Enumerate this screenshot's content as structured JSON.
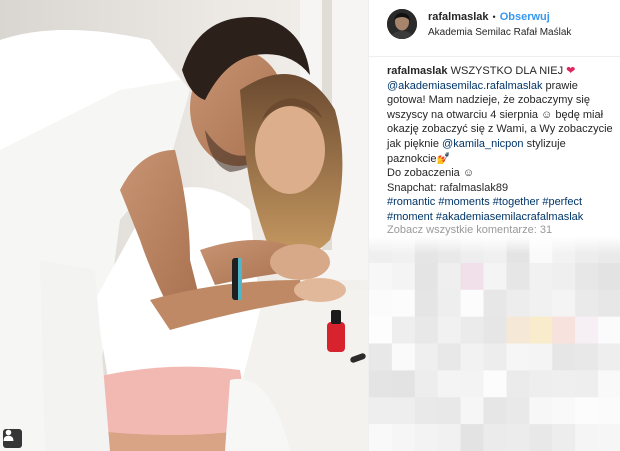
{
  "post": {
    "username": "rafalmaslak",
    "follow_label": "Obserwuj",
    "location": "Akademia Semilac Rafał Maślak"
  },
  "caption": {
    "username": "rafalmaslak",
    "line1_text": "WSZYSTKO DLA NIEJ",
    "mention_academy": "@akademiasemilac.rafalmaslak",
    "text_a": "prawie gotowa! Mam nadzieje, że zobaczymy się wszyscy na otwarciu 4 sierpnia ☺ będę miał okazję zobaczyć się z Wami, a Wy zobaczycie jak pięknie",
    "mention_kamila": "@kamila_nicpon",
    "text_b": "stylizuje paznokcie",
    "text_c": "Do zobaczenia ☺",
    "snapchat": "Snapchat: rafalmaslak89",
    "hashtags": [
      "#romantic",
      "#moments",
      "#together",
      "#perfect",
      "#moment",
      "#akademiasemilacrafalmaslak"
    ]
  },
  "comments": {
    "see_all_label": "Zobacz wszystkie komentarze: 31"
  },
  "icons": {
    "heart": "red-heart-icon",
    "nail_polish": "nail-polish-icon",
    "user_tag": "user-tag-icon"
  },
  "colors": {
    "link": "#003569",
    "follow": "#3897f0",
    "muted": "#999999",
    "heart": "#e0245e"
  }
}
